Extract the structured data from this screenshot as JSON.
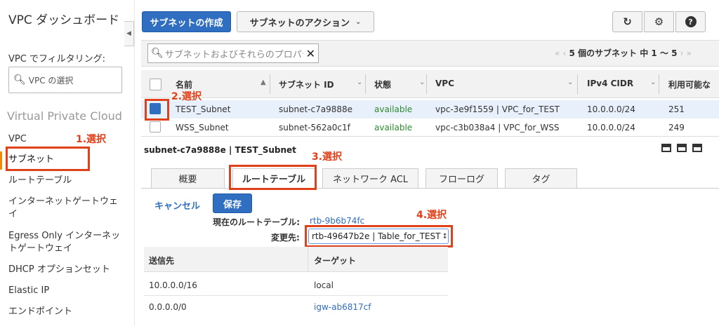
{
  "sidebar": {
    "title": "VPC ダッシュボード",
    "filter_label": "VPC でフィルタリング:",
    "vpc_select_placeholder": "VPC の選択",
    "section_title": "Virtual Private Cloud",
    "items": [
      {
        "label": "VPC"
      },
      {
        "label": "サブネット"
      },
      {
        "label": "ルートテーブル"
      },
      {
        "label": "インターネットゲートウェイ"
      },
      {
        "label": "Egress Only インターネットゲートウェイ"
      },
      {
        "label": "DHCP オプションセット"
      },
      {
        "label": "Elastic IP"
      },
      {
        "label": "エンドポイント"
      }
    ]
  },
  "toolbar": {
    "create_label": "サブネットの作成",
    "actions_label": "サブネットのアクション"
  },
  "search": {
    "placeholder": "サブネットおよびそれらのプロパティでフィルタリング"
  },
  "pager": {
    "text": "5 個のサブネット 中 1 〜 5"
  },
  "table": {
    "headers": [
      "名前",
      "サブネット ID",
      "状態",
      "VPC",
      "IPv4 CIDR",
      "利用可能な"
    ],
    "rows": [
      {
        "name": "TEST_Subnet",
        "id": "subnet-c7a9888e",
        "state": "available",
        "vpc": "vpc-3e9f1559 | VPC_for_TEST",
        "cidr": "10.0.0.0/24",
        "avail": "251"
      },
      {
        "name": "WSS_Subnet",
        "id": "subnet-562a0c1f",
        "state": "available",
        "vpc": "vpc-c3b038a4 | VPC_for_WSS",
        "cidr": "10.0.0.0/24",
        "avail": "249"
      }
    ]
  },
  "detail": {
    "title": "subnet-c7a9888e | TEST_Subnet",
    "tabs": [
      "概要",
      "ルートテーブル",
      "ネットワーク ACL",
      "フローログ",
      "タグ"
    ],
    "cancel_label": "キャンセル",
    "save_label": "保存",
    "current_rt_label": "現在のルートテーブル:",
    "current_rt_value": "rtb-9b6b74fc",
    "change_to_label": "変更先:",
    "change_to_value": "rtb-49647b2e | Table_for_TEST",
    "routes_headers": [
      "送信先",
      "ターゲット"
    ],
    "routes": [
      {
        "dest": "10.0.0.0/16",
        "target": "local"
      },
      {
        "dest": "0.0.0.0/0",
        "target": "igw-ab6817cf"
      }
    ]
  },
  "annotations": {
    "a1": "1.選択",
    "a2": "2.選択",
    "a3": "3.選択",
    "a4": "4.選択"
  },
  "colors": {
    "primary": "#2f6ec0",
    "annotation": "#e0411a",
    "available": "#2f8a2f",
    "selected_row": "#e8f0fb"
  }
}
